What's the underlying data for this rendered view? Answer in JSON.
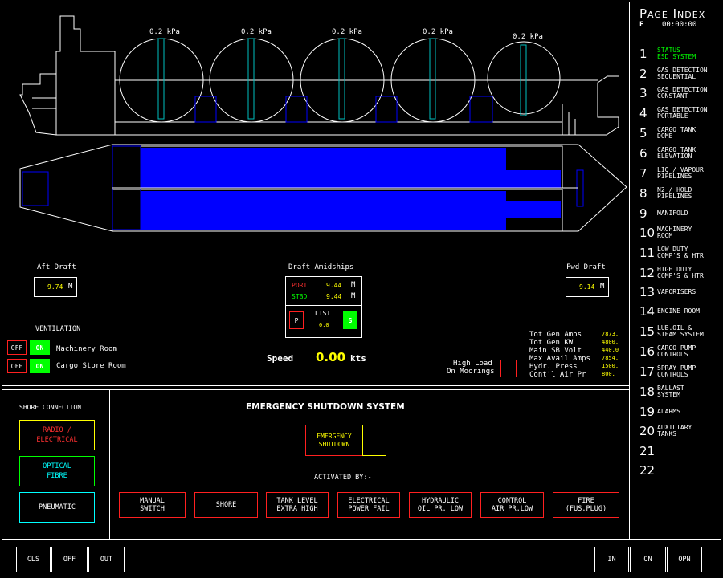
{
  "ship": {
    "tank_pressures": [
      "0.2 kPa",
      "0.2 kPa",
      "0.2 kPa",
      "0.2 kPa",
      "0.2 kPa"
    ]
  },
  "drafts": {
    "aft_label": "Aft Draft",
    "aft_value": "9.74",
    "aft_unit": "M",
    "fwd_label": "Fwd Draft",
    "fwd_value": "9.14",
    "fwd_unit": "M",
    "amidships_label": "Draft Amidships",
    "port_label": "PORT",
    "port_value": "9.44",
    "port_unit": "M",
    "stbd_label": "STBD",
    "stbd_value": "9.44",
    "stbd_unit": "M",
    "list_label": "LIST",
    "list_value": "0.0",
    "list_p": "P",
    "list_s": "S"
  },
  "ventilation": {
    "title": "VENTILATION",
    "rows": [
      {
        "off": "OFF",
        "on": "ON",
        "label": "Machinery Room"
      },
      {
        "off": "OFF",
        "on": "ON",
        "label": "Cargo Store Room"
      }
    ]
  },
  "speed": {
    "label": "Speed",
    "value": "0.00",
    "unit": "kts"
  },
  "high_load": {
    "line1": "High Load",
    "line2": "On Moorings"
  },
  "power": {
    "labels": [
      "Tot Gen Amps",
      "Tot Gen KW",
      "Main SB Volt",
      "Max Avail Amps",
      "Hydr. Press",
      "Cont'l Air Pr"
    ],
    "values": [
      "7873.",
      "4800.",
      "440.0",
      "7854.",
      "1500.",
      "800."
    ]
  },
  "shore": {
    "title": "SHORE CONNECTION",
    "radio": "RADIO /\nELECTRICAL",
    "optical": "OPTICAL\nFIBRE",
    "pneumatic": "PNEUMATIC"
  },
  "esd": {
    "title": "EMERGENCY SHUTDOWN SYSTEM",
    "button": "EMERGENCY\nSHUTDOWN",
    "activated_by": "ACTIVATED BY:-",
    "causes": [
      "MANUAL\nSWITCH",
      "SHORE",
      "TANK LEVEL\nEXTRA HIGH",
      "ELECTRICAL\nPOWER FAIL",
      "HYDRAULIC\nOIL PR. LOW",
      "CONTROL\nAIR PR.LOW",
      "FIRE\n(FUS.PLUG)"
    ]
  },
  "page_index": {
    "title": "Page Index",
    "sub_left": "F",
    "sub_time": "00:00:00",
    "items": [
      {
        "num": "1",
        "label": "STATUS\nESD SYSTEM"
      },
      {
        "num": "2",
        "label": "GAS DETECTION\nSEQUENTIAL"
      },
      {
        "num": "3",
        "label": "GAS DETECTION\nCONSTANT"
      },
      {
        "num": "4",
        "label": "GAS DETECTION\nPORTABLE"
      },
      {
        "num": "5",
        "label": "CARGO TANK\nDOME"
      },
      {
        "num": "6",
        "label": "CARGO TANK\nELEVATION"
      },
      {
        "num": "7",
        "label": "LIQ / VAPOUR\nPIPELINES"
      },
      {
        "num": "8",
        "label": "N2 / HOLD\nPIPELINES"
      },
      {
        "num": "9",
        "label": "MANIFOLD"
      },
      {
        "num": "10",
        "label": "MACHINERY\nROOM"
      },
      {
        "num": "11",
        "label": "LOW DUTY\nCOMP'S & HTR"
      },
      {
        "num": "12",
        "label": "HIGH DUTY\nCOMP'S & HTR"
      },
      {
        "num": "13",
        "label": "VAPORISERS"
      },
      {
        "num": "14",
        "label": "ENGINE ROOM"
      },
      {
        "num": "15",
        "label": "LUB.OIL &\nSTEAM SYSTEM"
      },
      {
        "num": "16",
        "label": "CARGO PUMP\nCONTROLS"
      },
      {
        "num": "17",
        "label": "SPRAY PUMP\nCONTROLS"
      },
      {
        "num": "18",
        "label": "BALLAST\nSYSTEM"
      },
      {
        "num": "19",
        "label": "ALARMS"
      },
      {
        "num": "20",
        "label": "AUXILIARY\nTANKS"
      },
      {
        "num": "21",
        "label": ""
      },
      {
        "num": "22",
        "label": ""
      }
    ],
    "active_color": "#00ff00"
  },
  "bottom_bar": {
    "cls": "CLS",
    "off": "OFF",
    "out": "OUT",
    "in": "IN",
    "on": "ON",
    "opn": "OPN"
  },
  "colors": {
    "cargo": "#0000ff",
    "alarm_border": "#ff2020",
    "ok": "#00ff00",
    "value": "#ffff00"
  }
}
